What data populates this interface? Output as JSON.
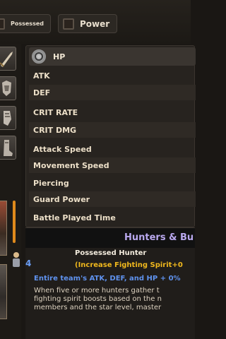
{
  "top_tabs": {
    "possessed_label": "Possessed",
    "power_label": "Power"
  },
  "stats": {
    "hp": "HP",
    "rows": [
      "ATK",
      "DEF",
      "CRIT RATE",
      "CRIT DMG",
      "Attack Speed",
      "Movement Speed",
      "Piercing",
      "Guard Power",
      "Battle Played Time"
    ]
  },
  "info": {
    "header": "Hunters & Bu",
    "count": "4",
    "title": "Possessed Hunter",
    "effect": "(Increase Fighting Spirit+0",
    "summary": "Entire team's ATK, DEF, and HP + 0%",
    "description": [
      "When five or more hunters gather t",
      "fighting spirit boosts based on the n",
      "members and the star level, master"
    ]
  },
  "colors": {
    "accent_purple": "#b9a8ee",
    "accent_gold": "#f0b81d",
    "accent_blue": "#5f92ee",
    "accent_orange": "#e08a1c"
  }
}
